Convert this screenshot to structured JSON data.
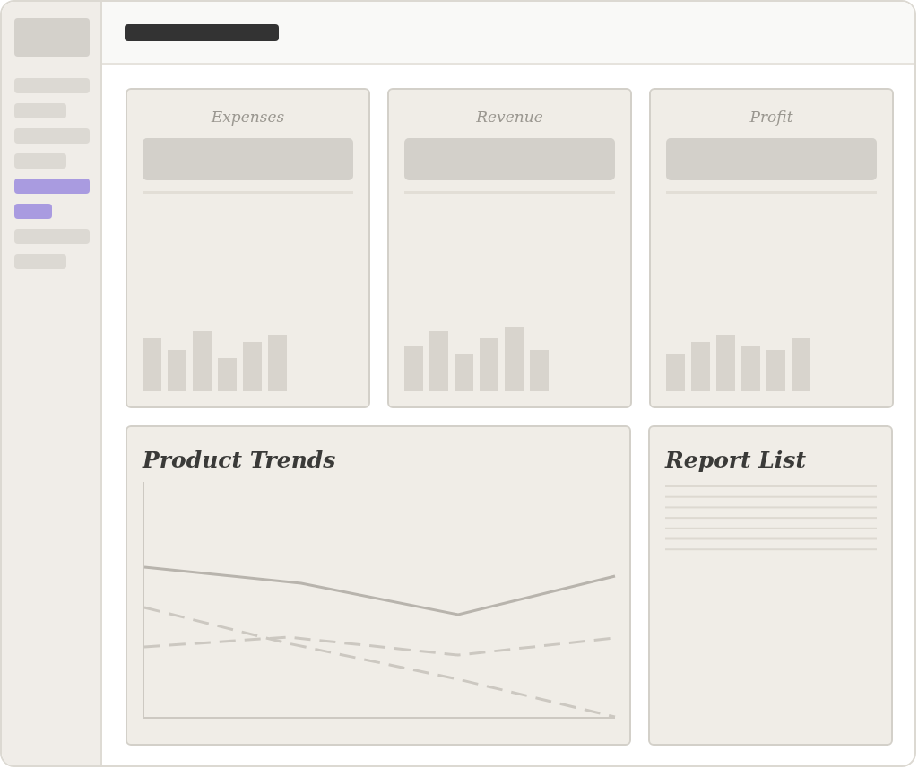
{
  "sidebar": {
    "items": [
      {
        "selected": false
      },
      {
        "selected": false
      },
      {
        "selected": false
      },
      {
        "selected": false
      },
      {
        "selected": true
      },
      {
        "selected": true
      },
      {
        "selected": false
      },
      {
        "selected": false
      }
    ]
  },
  "cards": [
    {
      "title": "Expenses"
    },
    {
      "title": "Revenue"
    },
    {
      "title": "Profit"
    }
  ],
  "panels": [
    {
      "kind": "chart",
      "title": "Product Trends"
    },
    {
      "kind": "list",
      "title": "Report List"
    }
  ]
}
